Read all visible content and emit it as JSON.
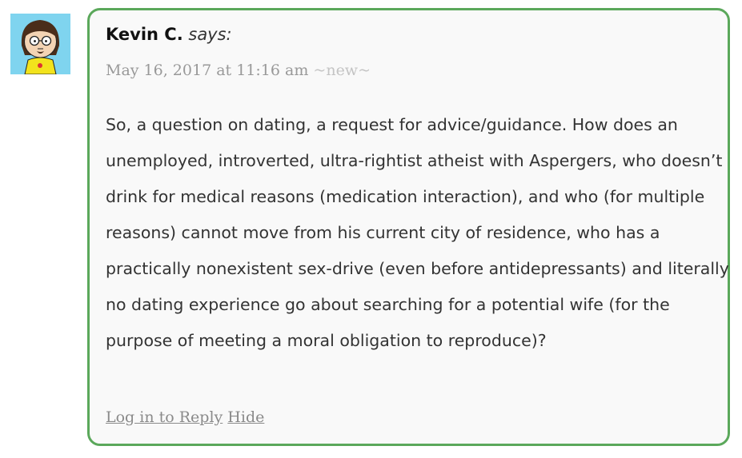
{
  "comment": {
    "avatar_icon": "south-park-style-avatar",
    "author": "Kevin C.",
    "says": "says:",
    "date": "May 16, 2017 at 11:16 am",
    "new_tag": "~new~",
    "body": "So, a question on dating, a request for advice/guidance. How does an unemployed, introverted, ultra-rightist atheist with Aspergers, who doesn’t drink for medical reasons (medication interaction), and who (for multiple reasons) cannot move from his current city of residence, who has a practically nonexistent sex-drive (even before antidepressants) and literally no dating experience go about searching for a potential wife (for the purpose of meeting a moral obligation to reproduce)?",
    "login_reply_label": "Log in to Reply",
    "hide_label": "Hide"
  },
  "colors": {
    "border": "#5ba85b",
    "box_background": "#f9f9f9",
    "avatar_background": "#7fd4ef",
    "meta_text": "#999999",
    "body_text": "#333333"
  }
}
